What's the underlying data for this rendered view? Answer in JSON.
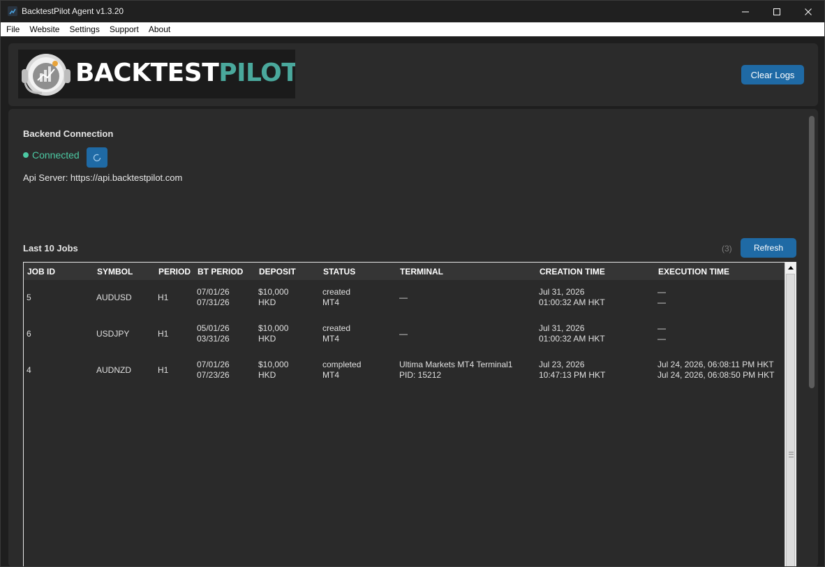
{
  "window": {
    "title": "BacktestPilot Agent v1.3.20"
  },
  "menu": [
    "File",
    "Website",
    "Settings",
    "Support",
    "About"
  ],
  "header": {
    "logo_text_a": "BACKTEST",
    "logo_text_b": "PILOT",
    "clear_logs_label": "Clear Logs"
  },
  "backend": {
    "title": "Backend Connection",
    "status": "Connected",
    "status_color": "#4cc9a3",
    "api_server": "Api Server: https://api.backtestpilot.com"
  },
  "jobs": {
    "title": "Last 10 Jobs",
    "count": "(3)",
    "refresh_label": "Refresh",
    "columns": [
      "JOB ID",
      "SYMBOL",
      "PERIOD",
      "BT PERIOD",
      "DEPOSIT",
      "STATUS",
      "TERMINAL",
      "CREATION TIME",
      "EXECUTION TIME"
    ],
    "rows": [
      {
        "job_id": "5",
        "symbol": "AUDUSD",
        "period": "H1",
        "bt_period": [
          "07/01/26",
          "07/31/26"
        ],
        "deposit": [
          "$10,000",
          "HKD"
        ],
        "status": [
          "created",
          "MT4"
        ],
        "terminal": [
          "—"
        ],
        "creation": [
          "Jul 31, 2026",
          "01:00:32 AM HKT"
        ],
        "execution": [
          "—",
          "—"
        ]
      },
      {
        "job_id": "6",
        "symbol": "USDJPY",
        "period": "H1",
        "bt_period": [
          "05/01/26",
          "03/31/26"
        ],
        "deposit": [
          "$10,000",
          "HKD"
        ],
        "status": [
          "created",
          "MT4"
        ],
        "terminal": [
          "—"
        ],
        "creation": [
          "Jul 31, 2026",
          "01:00:32 AM HKT"
        ],
        "execution": [
          "—",
          "—"
        ]
      },
      {
        "job_id": "4",
        "symbol": "AUDNZD",
        "period": "H1",
        "bt_period": [
          "07/01/26",
          "07/23/26"
        ],
        "deposit": [
          "$10,000",
          "HKD"
        ],
        "status": [
          "completed",
          "MT4"
        ],
        "terminal": [
          "Ultima Markets MT4 Terminal1",
          "PID: 15212"
        ],
        "creation": [
          "Jul 23, 2026",
          "10:47:13 PM HKT"
        ],
        "execution": [
          "Jul 24, 2026, 06:08:11 PM HKT",
          "Jul 24, 2026, 06:08:50 PM HKT"
        ]
      }
    ]
  },
  "colors": {
    "accent": "#1f6aa5",
    "logo_teal": "#4aa89c",
    "background": "#1e1e1e",
    "panel": "#2b2b2b"
  }
}
